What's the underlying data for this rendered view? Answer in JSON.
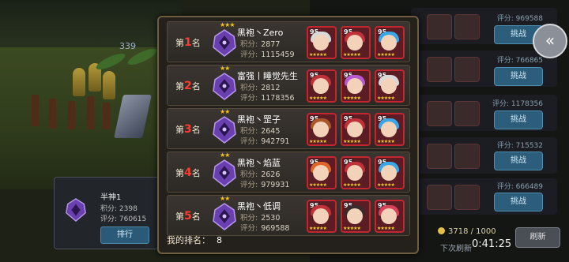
{
  "colors": {
    "rank_red": "#ff3b2f",
    "star_gold": "#f6c21a",
    "frame_red": "#c2262f",
    "dialog_bg": "#24201b",
    "emblem_purple": "#6a3fb0"
  },
  "dialog": {
    "my_rank_label": "我的排名：",
    "my_rank_value": "8",
    "score_key": "积分:",
    "rating_key": "评分:",
    "rows": [
      {
        "rank_prefix": "第",
        "rank_num": "1",
        "rank_suffix": "名",
        "stars": "★★★",
        "name": "黑袍丶Zero",
        "points": "2877",
        "rating": "1115459",
        "heroes": [
          {
            "level": "95",
            "hair": "#d9d9d9"
          },
          {
            "level": "95",
            "hair": "#c0313a"
          },
          {
            "level": "95",
            "hair": "#39a7e6"
          }
        ]
      },
      {
        "rank_prefix": "第",
        "rank_num": "2",
        "rank_suffix": "名",
        "stars": "★★",
        "name": "富强丨睡觉先生",
        "points": "2812",
        "rating": "1178356",
        "heroes": [
          {
            "level": "95",
            "hair": "#c0313a"
          },
          {
            "level": "95",
            "hair": "#b95bd0"
          },
          {
            "level": "95",
            "hair": "#d9d9d9"
          }
        ]
      },
      {
        "rank_prefix": "第",
        "rank_num": "3",
        "rank_suffix": "名",
        "stars": "★★",
        "name": "黑袍丶罡子",
        "points": "2645",
        "rating": "942791",
        "heroes": [
          {
            "level": "95",
            "hair": "#a9572b"
          },
          {
            "level": "95",
            "hair": "#c0313a"
          },
          {
            "level": "95",
            "hair": "#39a7e6"
          }
        ]
      },
      {
        "rank_prefix": "第",
        "rank_num": "4",
        "rank_suffix": "名",
        "stars": "★★",
        "name": "黑袍丶焰蓝",
        "points": "2626",
        "rating": "979931",
        "heroes": [
          {
            "level": "95",
            "hair": "#e0652b"
          },
          {
            "level": "95",
            "hair": "#c0313a"
          },
          {
            "level": "95",
            "hair": "#39a7e6"
          }
        ]
      },
      {
        "rank_prefix": "第",
        "rank_num": "5",
        "rank_suffix": "名",
        "stars": "★★",
        "name": "黑袍丶低调",
        "points": "2530",
        "rating": "969588",
        "heroes": [
          {
            "level": "95",
            "hair": "#c0313a"
          },
          {
            "level": "95",
            "hair": "#3a2a2a"
          },
          {
            "level": "95",
            "hair": "#d8435a"
          }
        ]
      }
    ]
  },
  "background": {
    "self_card": {
      "name": "半神1",
      "points_line": "积分: 2398",
      "rating_line": "评分: 760615",
      "button": "排行"
    },
    "side_rows": [
      {
        "score": "评分: 969588",
        "button": "挑战"
      },
      {
        "score": "评分: 766865",
        "button": "挑战"
      },
      {
        "score": "评分: 1178356",
        "button": "挑战"
      },
      {
        "score": "评分: 715532",
        "button": "挑战"
      },
      {
        "score": "评分: 666489",
        "button": "挑战"
      }
    ],
    "top_stat": "339",
    "coins": "3718 / 1000",
    "refresh_label": "下次刷新",
    "refresh_time": "0:41:25",
    "refresh_button": "刷新",
    "back_icon": "double-chevron-left-icon"
  }
}
